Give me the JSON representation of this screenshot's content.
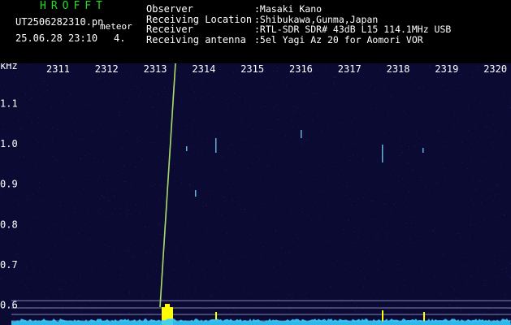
{
  "header": {
    "app_title": "HROFFT",
    "file_name": "UT2506282310.pn",
    "file_tag": "meteor",
    "datetime": "25.06.28 23:10",
    "counter": "4."
  },
  "info": [
    {
      "label": "Observer",
      "value": ":Masaki Kano"
    },
    {
      "label": "Receiving Location",
      "value": ":Shibukawa,Gunma,Japan"
    },
    {
      "label": "Receiver",
      "value": ":RTL-SDR SDR# 43dB L15 114.1MHz USB"
    },
    {
      "label": "Receiving antenna",
      "value": ":5el Yagi Az 20 for Aomori VOR"
    }
  ],
  "spectrogram": {
    "y_unit": "kHz",
    "y_ticks": [
      "1.1",
      "1.0",
      "0.9",
      "0.8",
      "0.7",
      "0.6"
    ],
    "time_ticks": [
      "2311",
      "2312",
      "2313",
      "2314",
      "2315",
      "2316",
      "2317",
      "2318",
      "2319",
      "2320"
    ],
    "colors": {
      "background": "#0a0a33",
      "noise": "#1a1a66",
      "trace": "#ffff00",
      "trace_core": "#4fd2ff",
      "baseline": "#33ccff",
      "reference_line": "#c8c8ff"
    }
  }
}
